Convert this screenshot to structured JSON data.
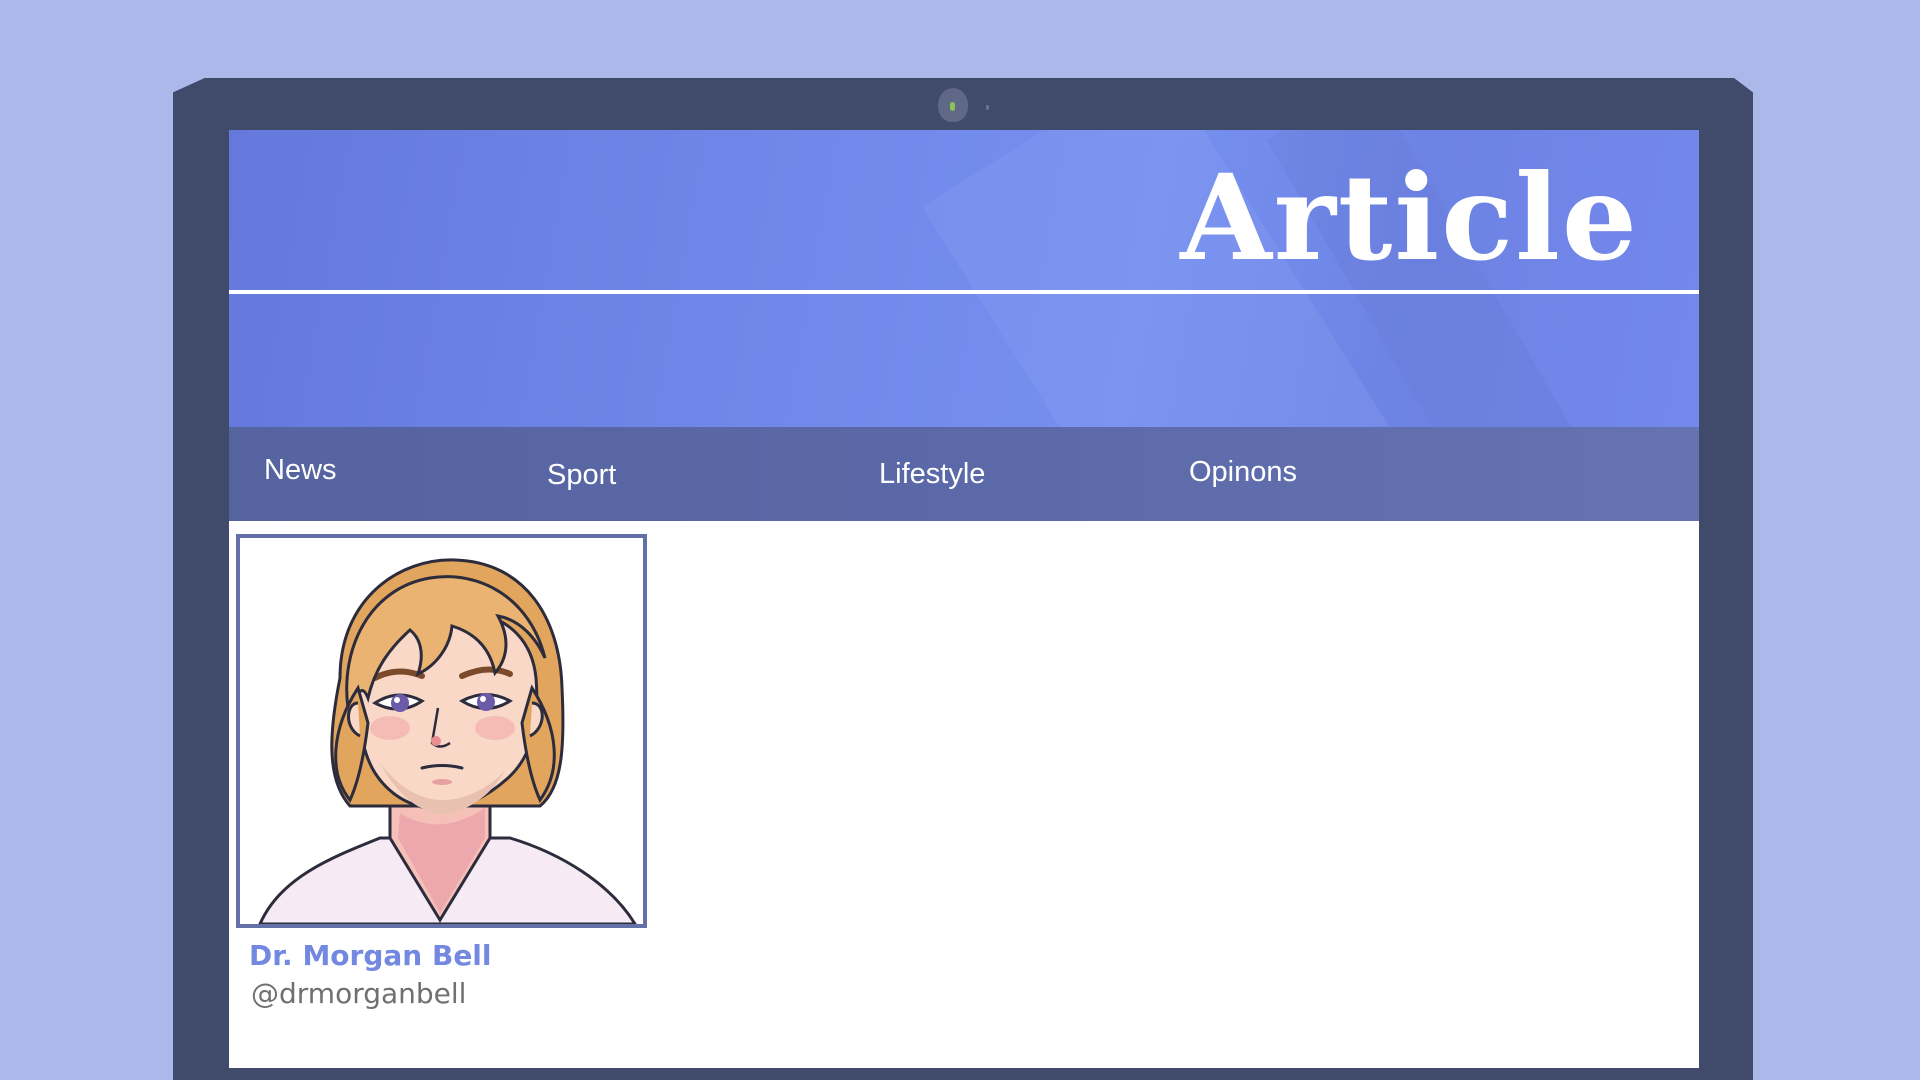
{
  "header": {
    "title": "Article"
  },
  "nav": {
    "items": [
      {
        "label": "News"
      },
      {
        "label": "Sport"
      },
      {
        "label": "Lifestyle"
      },
      {
        "label": "Opinons"
      }
    ]
  },
  "author": {
    "name": "Dr. Morgan Bell",
    "handle": "@drmorganbell"
  },
  "colors": {
    "background": "#adb8ea",
    "bezel": "#404a6a",
    "banner": "#7088e8",
    "nav": "#5b69a8",
    "author_name": "#7388e0"
  }
}
